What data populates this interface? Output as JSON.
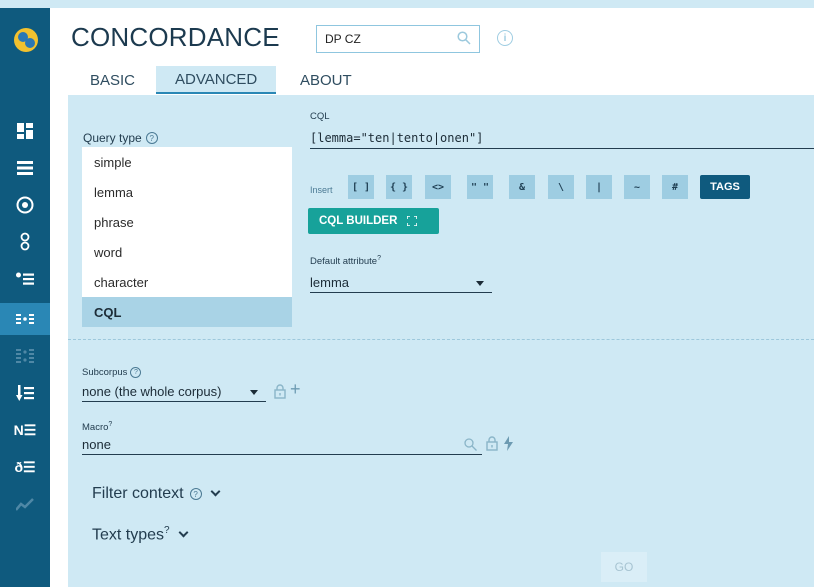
{
  "app": {
    "title": "CONCORDANCE"
  },
  "corpus": {
    "value": "DP CZ"
  },
  "tabs": [
    {
      "label": "BASIC"
    },
    {
      "label": "ADVANCED"
    },
    {
      "label": "ABOUT"
    }
  ],
  "query_type": {
    "label": "Query type",
    "options": [
      "simple",
      "lemma",
      "phrase",
      "word",
      "character",
      "CQL"
    ],
    "selected": "CQL"
  },
  "cql": {
    "label": "CQL",
    "value": "[lemma=\"ten|tento|onen\"]",
    "insert_label": "Insert",
    "insert_buttons": [
      "[ ]",
      "{ }",
      "<>",
      "\" \"",
      "&",
      "\\",
      "|",
      "~",
      "#"
    ],
    "tags_label": "TAGS",
    "builder_label": "CQL BUILDER"
  },
  "default_attribute": {
    "label": "Default attribute",
    "sup": "?",
    "value": "lemma"
  },
  "subcorpus": {
    "label": "Subcorpus",
    "value": "none (the whole corpus)"
  },
  "macro": {
    "label": "Macro",
    "sup": "?",
    "value": "none"
  },
  "filter_context": {
    "label": "Filter context"
  },
  "text_types": {
    "label": "Text types",
    "sup": "?"
  },
  "go": {
    "label": "GO"
  }
}
